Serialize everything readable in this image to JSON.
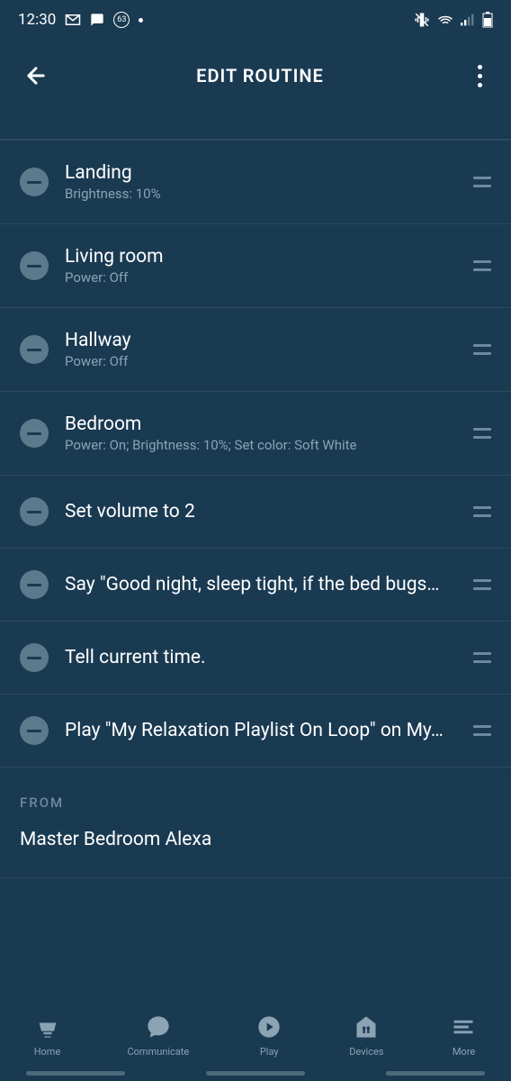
{
  "status_bar": {
    "time": "12:30",
    "badge_count": "63"
  },
  "header": {
    "title": "EDIT ROUTINE"
  },
  "actions": [
    {
      "title": "Landing",
      "subtitle": "Brightness: 10%"
    },
    {
      "title": "Living room",
      "subtitle": "Power: Off"
    },
    {
      "title": "Hallway",
      "subtitle": "Power: Off"
    },
    {
      "title": "Bedroom",
      "subtitle": "Power: On; Brightness: 10%; Set color: Soft White"
    },
    {
      "title": "Set volume to 2",
      "subtitle": ""
    },
    {
      "title": "Say \"Good night, sleep tight, if the bed bugs…",
      "subtitle": ""
    },
    {
      "title": "Tell current time.",
      "subtitle": ""
    },
    {
      "title": "Play \"My Relaxation Playlist On Loop\" on My…",
      "subtitle": ""
    }
  ],
  "from": {
    "label": "FROM",
    "device": "Master Bedroom Alexa"
  },
  "nav": {
    "home": "Home",
    "communicate": "Communicate",
    "play": "Play",
    "devices": "Devices",
    "more": "More"
  }
}
